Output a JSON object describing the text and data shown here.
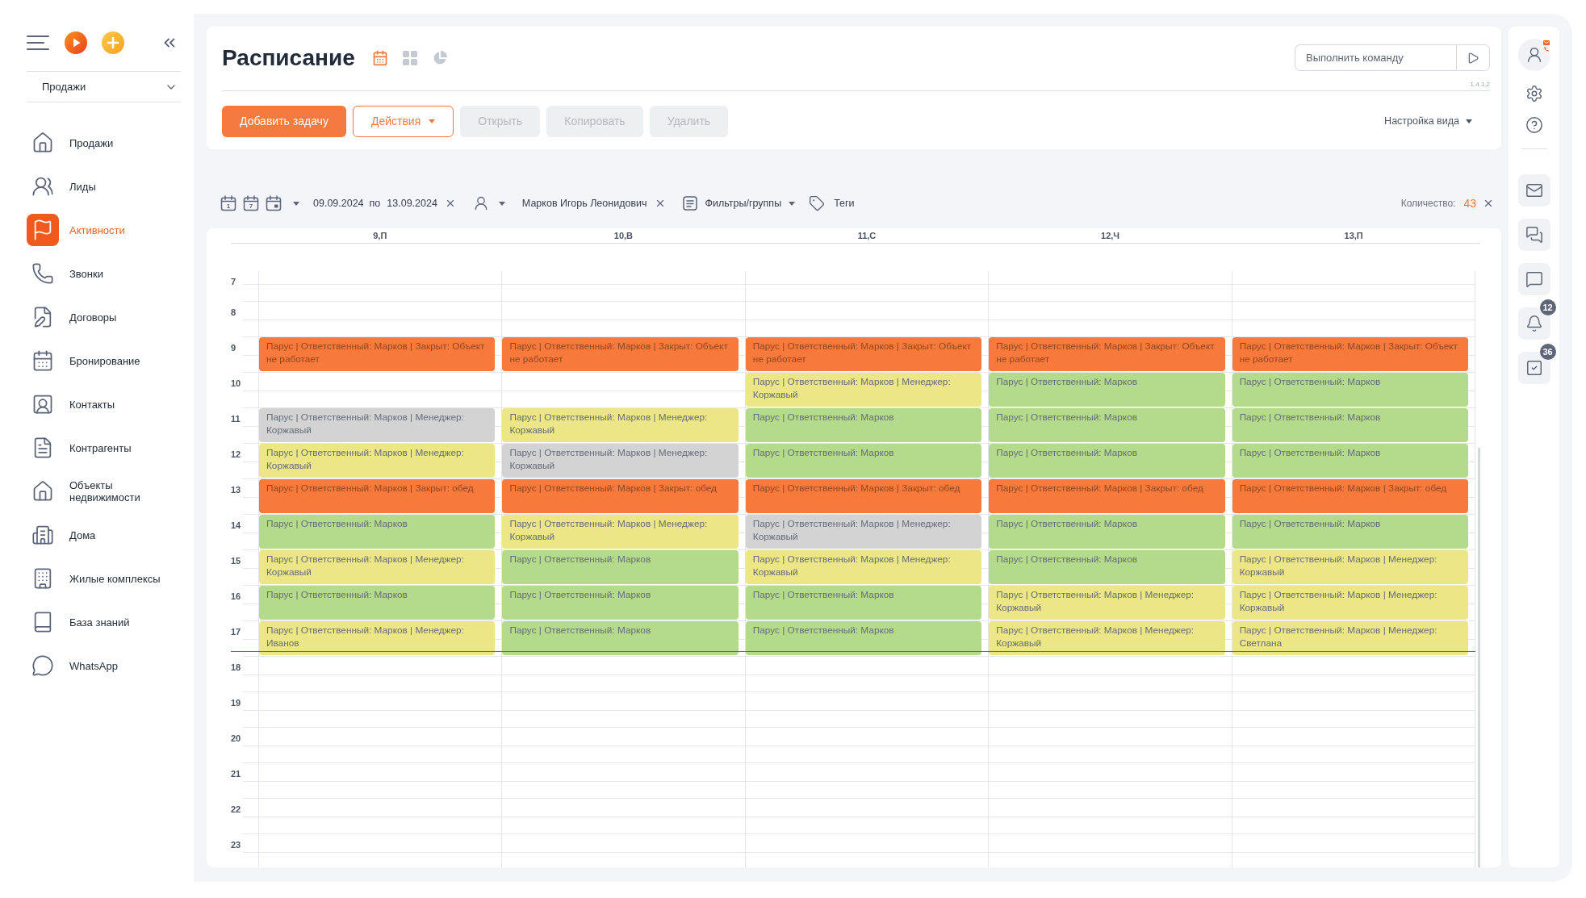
{
  "sidebar": {
    "section": "Продажи",
    "items": [
      {
        "kind": "house",
        "label": "Продажи",
        "selected": false
      },
      {
        "kind": "leads",
        "label": "Лиды",
        "selected": false
      },
      {
        "kind": "flag",
        "label": "Активности",
        "selected": true
      },
      {
        "kind": "phone",
        "label": "Звонки",
        "selected": false
      },
      {
        "kind": "contract",
        "label": "Договоры",
        "selected": false
      },
      {
        "kind": "calendar",
        "label": "Бронирование",
        "selected": false
      },
      {
        "kind": "contact",
        "label": "Контакты",
        "selected": false
      },
      {
        "kind": "document",
        "label": "Контрагенты",
        "selected": false
      },
      {
        "kind": "estate",
        "label": "Объекты недвижимости",
        "selected": false
      },
      {
        "kind": "building",
        "label": "Дома",
        "selected": false
      },
      {
        "kind": "complex",
        "label": "Жилые комплексы",
        "selected": false
      },
      {
        "kind": "book",
        "label": "База знаний",
        "selected": false
      },
      {
        "kind": "messenger",
        "label": "WhatsApp",
        "selected": false
      }
    ]
  },
  "header": {
    "title": "Расписание",
    "views": [
      {
        "kind": "calendar",
        "selected": true
      },
      {
        "kind": "grid",
        "selected": false
      },
      {
        "kind": "chart",
        "selected": false
      }
    ],
    "command": {
      "placeholder": "Выполнить команду"
    },
    "version": "1.4.1.2"
  },
  "toolbar": {
    "buttons": [
      {
        "kind": "primary",
        "label": "Добавить задачу",
        "disabled": false
      },
      {
        "kind": "menu",
        "label": "Действия",
        "disabled": false
      },
      {
        "kind": "plain",
        "label": "Открыть",
        "disabled": true
      },
      {
        "kind": "plain",
        "label": "Копировать",
        "disabled": true
      },
      {
        "kind": "plain",
        "label": "Удалить",
        "disabled": true
      }
    ],
    "view_settings": "Настройка вида"
  },
  "filters": {
    "ranges": [
      {
        "kind": "day",
        "label": "1"
      },
      {
        "kind": "week",
        "label": "7"
      },
      {
        "kind": "month"
      }
    ],
    "date_from": "09.09.2024",
    "date_separator": "по",
    "date_to": "13.09.2024",
    "assignee": "Марков Игорь Леонидович",
    "groups": "Фильтры/группы",
    "tags": "Теги",
    "count_label": "Количество:",
    "count": "43"
  },
  "schedule": {
    "hours": [
      "7",
      "8",
      "9",
      "10",
      "11",
      "12",
      "13",
      "14",
      "15",
      "16",
      "17",
      "18",
      "19",
      "20",
      "21",
      "22",
      "23"
    ],
    "days": [
      {
        "label": "9,П",
        "slots": [
          {
            "kind": "free"
          },
          {
            "kind": "free"
          },
          {
            "kind": "task",
            "text": "Парус | Ответственный: Марков | Закрыт: Объект не работает",
            "color": "#f77a3c"
          },
          {
            "kind": "free"
          },
          {
            "kind": "task",
            "text": "Парус | Ответственный: Марков | Менеджер: Коржавый",
            "color": "#d3d3d3"
          },
          {
            "kind": "task",
            "text": "Парус | Ответственный: Марков | Менеджер: Коржавый",
            "color": "#ece686"
          },
          {
            "kind": "task",
            "text": "Парус | Ответственный: Марков | Закрыт: обед",
            "color": "#f77a3c"
          },
          {
            "kind": "task",
            "text": "Парус | Ответственный: Марков",
            "color": "#b3db8b"
          },
          {
            "kind": "task",
            "text": "Парус | Ответственный: Марков | Менеджер: Коржавый",
            "color": "#ece686"
          },
          {
            "kind": "task",
            "text": "Парус | Ответственный: Марков",
            "color": "#b3db8b"
          },
          {
            "kind": "task",
            "text": "Парус | Ответственный: Марков | Менеджер: Иванов",
            "color": "#ece686"
          }
        ]
      },
      {
        "label": "10,В",
        "slots": [
          {
            "kind": "free"
          },
          {
            "kind": "free"
          },
          {
            "kind": "task",
            "text": "Парус | Ответственный: Марков | Закрыт: Объект не работает",
            "color": "#f77a3c"
          },
          {
            "kind": "free"
          },
          {
            "kind": "task",
            "text": "Парус | Ответственный: Марков | Менеджер: Коржавый",
            "color": "#ece686"
          },
          {
            "kind": "task",
            "text": "Парус | Ответственный: Марков | Менеджер: Коржавый",
            "color": "#d3d3d3"
          },
          {
            "kind": "task",
            "text": "Парус | Ответственный: Марков | Закрыт: обед",
            "color": "#f77a3c"
          },
          {
            "kind": "task",
            "text": "Парус | Ответственный: Марков | Менеджер: Коржавый",
            "color": "#ece686"
          },
          {
            "kind": "task",
            "text": "Парус | Ответственный: Марков",
            "color": "#b3db8b"
          },
          {
            "kind": "task",
            "text": "Парус | Ответственный: Марков",
            "color": "#b3db8b"
          },
          {
            "kind": "task",
            "text": "Парус | Ответственный: Марков",
            "color": "#b3db8b"
          }
        ]
      },
      {
        "label": "11,С",
        "slots": [
          {
            "kind": "free"
          },
          {
            "kind": "free"
          },
          {
            "kind": "task",
            "text": "Парус | Ответственный: Марков | Закрыт: Объект не работает",
            "color": "#f77a3c"
          },
          {
            "kind": "task",
            "text": "Парус | Ответственный: Марков | Менеджер: Коржавый",
            "color": "#ece686"
          },
          {
            "kind": "task",
            "text": "Парус | Ответственный: Марков",
            "color": "#b3db8b"
          },
          {
            "kind": "task",
            "text": "Парус | Ответственный: Марков",
            "color": "#b3db8b"
          },
          {
            "kind": "task",
            "text": "Парус | Ответственный: Марков | Закрыт: обед",
            "color": "#f77a3c"
          },
          {
            "kind": "task",
            "text": "Парус | Ответственный: Марков | Менеджер: Коржавый",
            "color": "#d3d3d3"
          },
          {
            "kind": "task",
            "text": "Парус | Ответственный: Марков | Менеджер: Коржавый",
            "color": "#ece686"
          },
          {
            "kind": "task",
            "text": "Парус | Ответственный: Марков",
            "color": "#b3db8b"
          },
          {
            "kind": "task",
            "text": "Парус | Ответственный: Марков",
            "color": "#b3db8b"
          }
        ]
      },
      {
        "label": "12,Ч",
        "slots": [
          {
            "kind": "free"
          },
          {
            "kind": "free"
          },
          {
            "kind": "task",
            "text": "Парус | Ответственный: Марков | Закрыт: Объект не работает",
            "color": "#f77a3c"
          },
          {
            "kind": "task",
            "text": "Парус | Ответственный: Марков",
            "color": "#b3db8b"
          },
          {
            "kind": "task",
            "text": "Парус | Ответственный: Марков",
            "color": "#b3db8b"
          },
          {
            "kind": "task",
            "text": "Парус | Ответственный: Марков",
            "color": "#b3db8b"
          },
          {
            "kind": "task",
            "text": "Парус | Ответственный: Марков | Закрыт: обед",
            "color": "#f77a3c"
          },
          {
            "kind": "task",
            "text": "Парус | Ответственный: Марков",
            "color": "#b3db8b"
          },
          {
            "kind": "task",
            "text": "Парус | Ответственный: Марков",
            "color": "#b3db8b"
          },
          {
            "kind": "task",
            "text": "Парус | Ответственный: Марков | Менеджер: Коржавый",
            "color": "#ece686"
          },
          {
            "kind": "task",
            "text": "Парус | Ответственный: Марков | Менеджер: Коржавый",
            "color": "#ece686"
          }
        ]
      },
      {
        "label": "13,П",
        "slots": [
          {
            "kind": "free"
          },
          {
            "kind": "free"
          },
          {
            "kind": "task",
            "text": "Парус | Ответственный: Марков | Закрыт: Объект не работает",
            "color": "#f77a3c"
          },
          {
            "kind": "task",
            "text": "Парус | Ответственный: Марков",
            "color": "#b3db8b"
          },
          {
            "kind": "task",
            "text": "Парус | Ответственный: Марков",
            "color": "#b3db8b"
          },
          {
            "kind": "task",
            "text": "Парус | Ответственный: Марков",
            "color": "#b3db8b"
          },
          {
            "kind": "task",
            "text": "Парус | Ответственный: Марков | Закрыт: обед",
            "color": "#f77a3c"
          },
          {
            "kind": "task",
            "text": "Парус | Ответственный: Марков",
            "color": "#b3db8b"
          },
          {
            "kind": "task",
            "text": "Парус | Ответственный: Марков | Менеджер: Коржавый",
            "color": "#ece686"
          },
          {
            "kind": "task",
            "text": "Парус | Ответственный: Марков | Менеджер: Коржавый",
            "color": "#ece686"
          },
          {
            "kind": "task",
            "text": "Парус | Ответственный: Марков | Менеджер: Светлана",
            "color": "#ece686"
          }
        ]
      }
    ]
  },
  "right_rail": {
    "tiles": [
      {
        "kind": "mail"
      },
      {
        "kind": "chats"
      },
      {
        "kind": "comment"
      },
      {
        "kind": "bell",
        "badge": "12"
      },
      {
        "kind": "tasks",
        "badge": "36"
      }
    ]
  }
}
